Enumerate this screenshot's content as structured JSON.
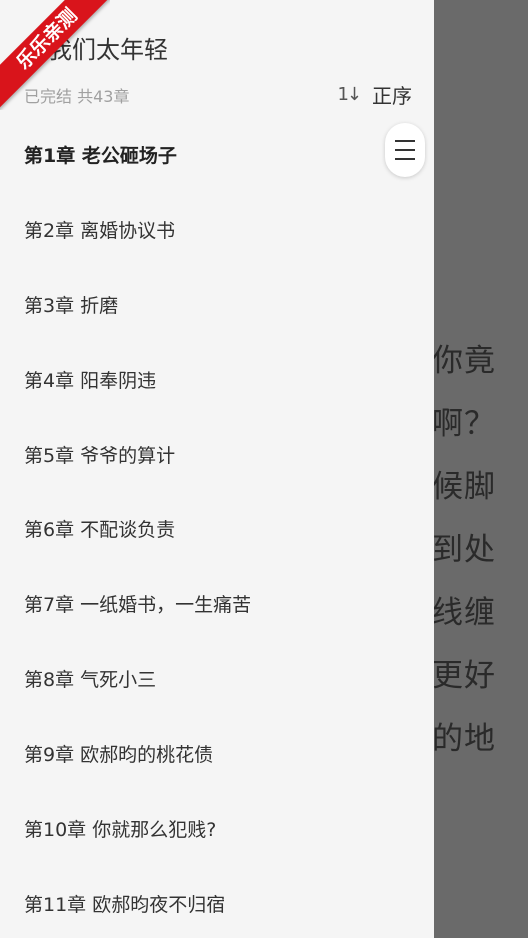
{
  "reader": {
    "lines": [
      "你竟",
      "啊？",
      "候脚",
      "到处",
      "线缠",
      "更好",
      "的地"
    ]
  },
  "drawer": {
    "title": "时我们太年轻",
    "meta": "已完结 共43章",
    "sort_icon": "1↓",
    "sort_label": "正序",
    "chapters": [
      "第1章 老公砸场子",
      "第2章 离婚协议书",
      "第3章 折磨",
      "第4章 阳奉阴违",
      "第5章 爷爷的算计",
      "第6章 不配谈负责",
      "第7章 一纸婚书，一生痛苦",
      "第8章 气死小三",
      "第9章 欧郝昀的桃花债",
      "第10章 你就那么犯贱?",
      "第11章 欧郝昀夜不归宿"
    ]
  },
  "ribbon": {
    "text": "乐乐亲测"
  },
  "colors": {
    "ribbon": "#d9141b",
    "drawer_bg": "#f5f5f5",
    "overlay": "#6a6a6a"
  }
}
